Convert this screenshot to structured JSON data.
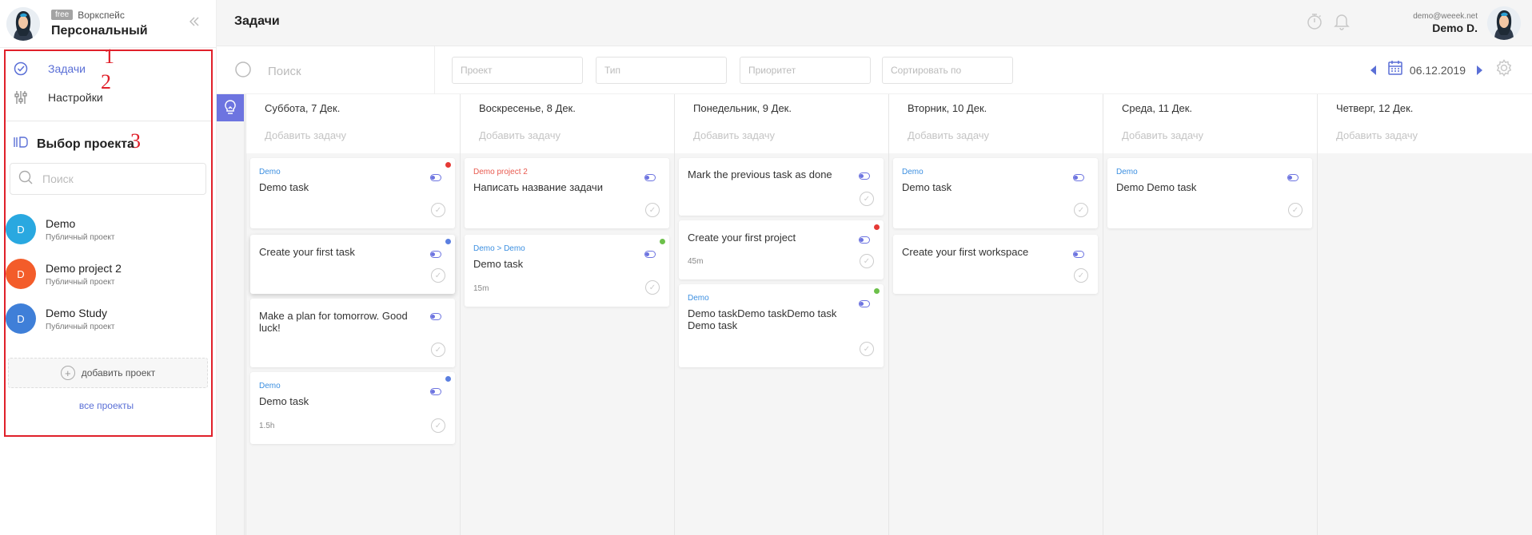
{
  "workspace": {
    "badge": "free",
    "label": "Воркспейс",
    "name": "Персональный"
  },
  "annotations": [
    "1",
    "2",
    "3"
  ],
  "nav": [
    {
      "label": "Задачи",
      "icon": "check-circle-icon",
      "active": true
    },
    {
      "label": "Настройки",
      "icon": "sliders-icon",
      "active": false
    }
  ],
  "project_select": {
    "title": "Выбор проекта",
    "search_placeholder": "Поиск"
  },
  "projects": [
    {
      "initial": "D",
      "name": "Demo",
      "sub": "Публичный проект",
      "color": "#29a8e0"
    },
    {
      "initial": "D",
      "name": "Demo project 2",
      "sub": "Публичный проект",
      "color": "#f35c2a"
    },
    {
      "initial": "D",
      "name": "Demo Study",
      "sub": "Публичный проект",
      "color": "#3f7fd8"
    }
  ],
  "add_project_label": "добавить проект",
  "all_projects_label": "все проекты",
  "header": {
    "title": "Задачи",
    "email": "demo@weeek.net",
    "user": "Demo D."
  },
  "filters": {
    "search_placeholder": "Поиск",
    "project": "Проект",
    "type": "Тип",
    "priority": "Приоритет",
    "sort": "Сортировать по",
    "date": "06.12.2019"
  },
  "add_task_label": "Добавить задачу",
  "columns": [
    {
      "date": "Суббота, 7 Дек.",
      "cards": [
        {
          "project": "Demo",
          "project_color": "#3c8fe0",
          "title": "Demo task",
          "dot": "#e53935"
        },
        {
          "project": "",
          "title": "Create your first task",
          "dot": "#5b7fe0",
          "raised": true
        },
        {
          "project": "",
          "title": "Make a plan for tomorrow. Good luck!"
        },
        {
          "project": "Demo",
          "project_color": "#3c8fe0",
          "title": "Demo task",
          "time": "1.5h",
          "dot": "#5b7fe0"
        }
      ]
    },
    {
      "date": "Воскресенье, 8 Дек.",
      "cards": [
        {
          "project": "Demo project 2",
          "project_color": "#e85a4f",
          "title": "Написать название задачи"
        },
        {
          "project": "Demo > Demo",
          "project_color": "#3c8fe0",
          "title": "Demo task",
          "time": "15m",
          "dot": "#6cc04a"
        }
      ]
    },
    {
      "date": "Понедельник, 9 Дек.",
      "cards": [
        {
          "project": "",
          "title": "Mark the previous task as done"
        },
        {
          "project": "",
          "title": "Create your first project",
          "time": "45m",
          "dot": "#e53935"
        },
        {
          "project": "Demo",
          "project_color": "#3c8fe0",
          "title": "Demo taskDemo taskDemo task Demo task",
          "dot": "#6cc04a"
        }
      ]
    },
    {
      "date": "Вторник, 10 Дек.",
      "cards": [
        {
          "project": "Demo",
          "project_color": "#3c8fe0",
          "title": "Demo task"
        },
        {
          "project": "",
          "title": "Create your first workspace"
        }
      ]
    },
    {
      "date": "Среда, 11 Дек.",
      "cards": [
        {
          "project": "Demo",
          "project_color": "#3c8fe0",
          "title": "Demo Demo task"
        }
      ]
    },
    {
      "date": "Четверг, 12 Дек.",
      "cards": []
    }
  ]
}
